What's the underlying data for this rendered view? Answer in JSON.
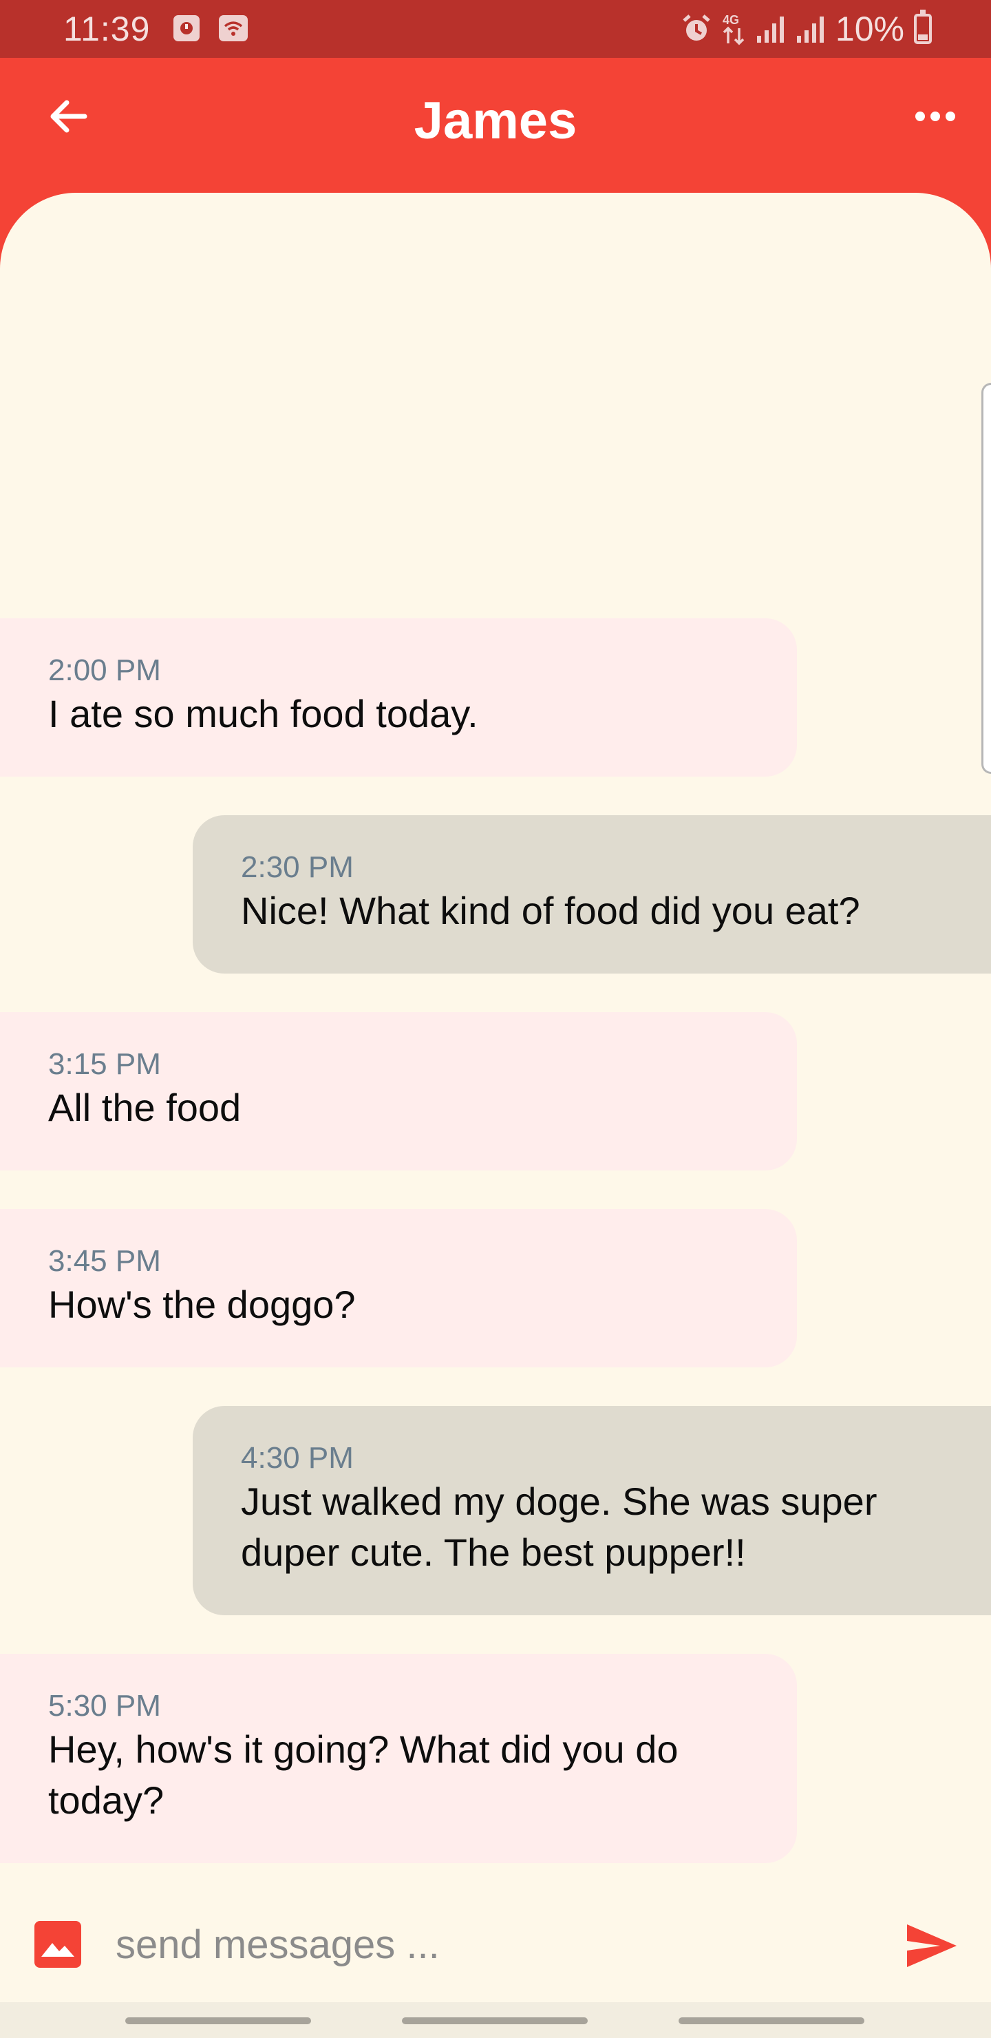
{
  "status_bar": {
    "time": "11:39",
    "battery_text": "10%",
    "icons": [
      "media-icon",
      "wifi-hotspot-icon",
      "alarm-icon",
      "4g-data-icon",
      "signal-icon",
      "signal-icon",
      "battery-charging-icon"
    ]
  },
  "header": {
    "title": "James",
    "back_icon": "arrow-left-icon",
    "more_icon": "more-horizontal-icon",
    "color": "#F44336"
  },
  "messages": [
    {
      "direction": "incoming",
      "time": "2:00 PM",
      "text": "I ate so much food today."
    },
    {
      "direction": "outgoing",
      "time": "2:30 PM",
      "text": "Nice! What kind of food did you eat?"
    },
    {
      "direction": "incoming",
      "time": "3:15 PM",
      "text": "All the food"
    },
    {
      "direction": "incoming",
      "time": "3:45 PM",
      "text": "How's the doggo?"
    },
    {
      "direction": "outgoing",
      "time": "4:30 PM",
      "text": "Just walked my doge. She was super duper cute. The best pupper!!"
    },
    {
      "direction": "incoming",
      "time": "5:30 PM",
      "text": "Hey, how's it going? What did you do today?"
    }
  ],
  "composer": {
    "placeholder": "send messages ...",
    "value": "",
    "image_icon": "image-icon",
    "send_icon": "send-icon"
  },
  "colors": {
    "accent": "#F44336",
    "status_bar": "#B8312B",
    "chat_background": "#FEF8E9",
    "incoming_bubble": "#FFEDEC",
    "outgoing_bubble": "#DFDBCF",
    "timestamp": "#6A7E8E"
  }
}
